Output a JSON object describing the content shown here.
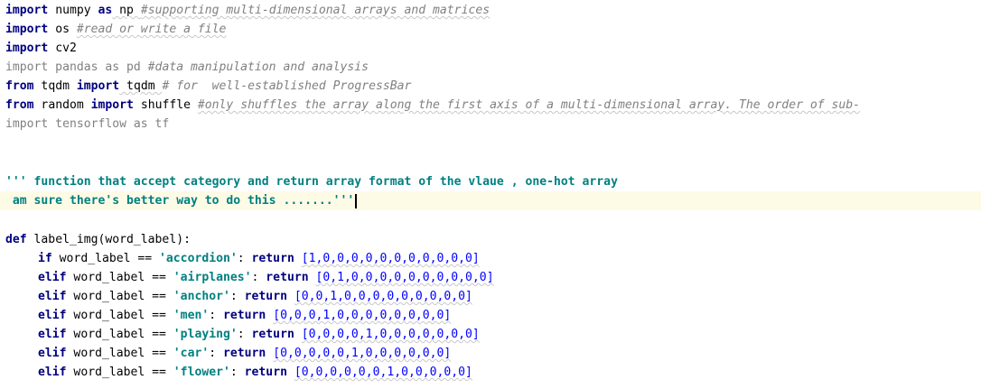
{
  "editor": {
    "lines": [
      {
        "kw": "import",
        "text": " numpy ",
        "kw2": "as",
        "text2": " np ",
        "comment": "#supporting multi-dimensional arrays and matrices"
      },
      {
        "kw": "import",
        "text": " os ",
        "comment": "#read or write a file"
      },
      {
        "kw": "import",
        "text": " cv2"
      },
      {
        "text": "import pandas as pd ",
        "comment": "#data manipulation and analysis"
      },
      {
        "kw": "from",
        "text": " tqdm ",
        "kw2": "import",
        "text2": " tqdm ",
        "comment": "# for  well-established ProgressBar"
      },
      {
        "kw": "from",
        "text": " random ",
        "kw2": "import",
        "text2": " shuffle ",
        "comment": "#only shuffles the array along the first axis of a multi-dimensional array. The order of sub-"
      },
      {
        "text": "import tensorflow as tf"
      }
    ],
    "docstring": [
      "''' function that accept category and return array format of the vlaue , one-hot array",
      " am sure there's better way to do this .......'''"
    ],
    "def_line": {
      "kw": "def",
      "text": " label_img(word_label):"
    },
    "branches": [
      {
        "kw": "if",
        "label": "'accordion'",
        "list": "[1,0,0,0,0,0,0,0,0,0,0,0]"
      },
      {
        "kw": "elif",
        "label": "'airplanes'",
        "list": "[0,1,0,0,0,0,0,0,0,0,0,0]"
      },
      {
        "kw": "elif",
        "label": "'anchor'",
        "list": "[0,0,1,0,0,0,0,0,0,0,0,0]"
      },
      {
        "kw": "elif",
        "label": "'men'",
        "list": "[0,0,0,1,0,0,0,0,0,0,0,0]"
      },
      {
        "kw": "elif",
        "label": "'playing'",
        "list": "[0,0,0,0,1,0,0,0,0,0,0,0]"
      },
      {
        "kw": "elif",
        "label": "'car'",
        "list": "[0,0,0,0,0,1,0,0,0,0,0,0]"
      },
      {
        "kw": "elif",
        "label": "'flower'",
        "list": "[0,0,0,0,0,0,1,0,0,0,0,0]"
      }
    ],
    "branch_text": " word_label == ",
    "return_kw": "return",
    "colon": ": "
  }
}
